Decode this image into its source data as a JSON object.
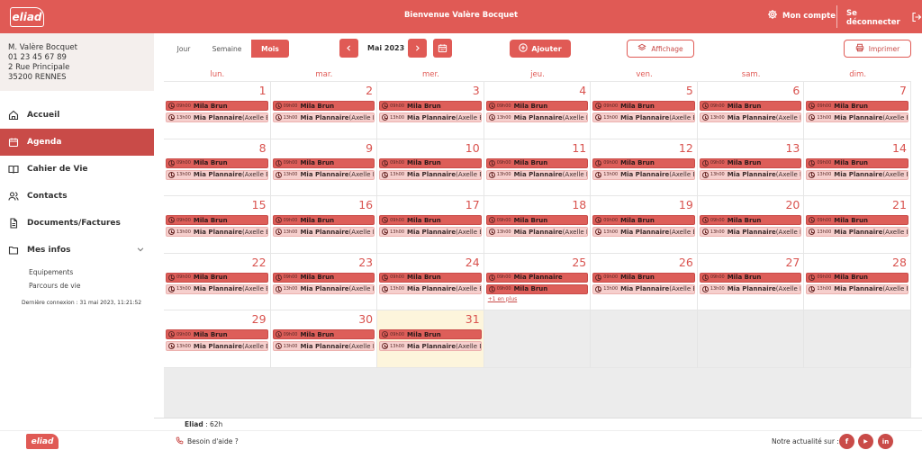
{
  "header": {
    "logo_text": "eliad",
    "welcome": "Bienvenue Valère Bocquet",
    "account_label": "Mon compte",
    "logout_label": "Se déconnecter"
  },
  "user": {
    "name": "M. Valère Bocquet",
    "phone": "01 23 45 67 89",
    "street": "2 Rue Principale",
    "city": "35200 RENNES"
  },
  "nav": {
    "items": [
      {
        "label": "Accueil",
        "icon": "home-icon"
      },
      {
        "label": "Agenda",
        "icon": "calendar-icon",
        "active": true
      },
      {
        "label": "Cahier de Vie",
        "icon": "book-icon"
      },
      {
        "label": "Contacts",
        "icon": "users-icon"
      },
      {
        "label": "Documents/Factures",
        "icon": "document-icon"
      },
      {
        "label": "Mes infos",
        "icon": "folder-icon"
      }
    ],
    "sub_items": [
      "Equipements",
      "Parcours de vie"
    ],
    "last_connection": "Dernière connexion : 31 mai 2023, 11:21:52"
  },
  "toolbar": {
    "views": [
      "Jour",
      "Semaine",
      "Mois"
    ],
    "active_view": "Mois",
    "month": "Mai 2023",
    "add_label": "Ajouter",
    "display_label": "Affichage",
    "print_label": "Imprimer"
  },
  "calendar": {
    "weekdays": [
      "lun.",
      "mar.",
      "mer.",
      "jeu.",
      "ven.",
      "sam.",
      "dim."
    ],
    "more_label": "+1 en plus",
    "weeks": [
      [
        {
          "day": "1",
          "events": [
            {
              "t": "09h00",
              "n": "Mila Brun",
              "k": "dark"
            },
            {
              "t": "13h00",
              "n": "Mia Plannaire",
              "s": "(Axelle Bocquet)",
              "k": "light"
            }
          ]
        },
        {
          "day": "2",
          "events": [
            {
              "t": "09h00",
              "n": "Mila Brun",
              "k": "dark"
            },
            {
              "t": "13h00",
              "n": "Mia Plannaire",
              "s": "(Axelle Bocquet)",
              "k": "light"
            }
          ]
        },
        {
          "day": "3",
          "events": [
            {
              "t": "09h00",
              "n": "Mila Brun",
              "k": "dark"
            },
            {
              "t": "13h00",
              "n": "Mia Plannaire",
              "s": "(Axelle Bocquet)",
              "k": "light"
            }
          ]
        },
        {
          "day": "4",
          "events": [
            {
              "t": "09h00",
              "n": "Mila Brun",
              "k": "dark"
            },
            {
              "t": "13h00",
              "n": "Mia Plannaire",
              "s": "(Axelle Bocquet)",
              "k": "light"
            }
          ]
        },
        {
          "day": "5",
          "events": [
            {
              "t": "09h00",
              "n": "Mila Brun",
              "k": "dark"
            },
            {
              "t": "13h00",
              "n": "Mia Plannaire",
              "s": "(Axelle Bocquet)",
              "k": "light"
            }
          ]
        },
        {
          "day": "6",
          "events": [
            {
              "t": "09h00",
              "n": "Mila Brun",
              "k": "dark"
            },
            {
              "t": "13h00",
              "n": "Mia Plannaire",
              "s": "(Axelle Bocquet)",
              "k": "light"
            }
          ]
        },
        {
          "day": "7",
          "events": [
            {
              "t": "09h00",
              "n": "Mila Brun",
              "k": "dark"
            },
            {
              "t": "13h00",
              "n": "Mia Plannaire",
              "s": "(Axelle Bocquet)",
              "k": "light"
            }
          ]
        }
      ],
      [
        {
          "day": "8",
          "events": [
            {
              "t": "09h00",
              "n": "Mila Brun",
              "k": "dark"
            },
            {
              "t": "13h00",
              "n": "Mia Plannaire",
              "s": "(Axelle Bocquet)",
              "k": "light"
            }
          ]
        },
        {
          "day": "9",
          "events": [
            {
              "t": "09h00",
              "n": "Mila Brun",
              "k": "dark"
            },
            {
              "t": "13h00",
              "n": "Mia Plannaire",
              "s": "(Axelle Bocquet)",
              "k": "light"
            }
          ]
        },
        {
          "day": "10",
          "events": [
            {
              "t": "09h00",
              "n": "Mila Brun",
              "k": "dark"
            },
            {
              "t": "13h00",
              "n": "Mia Plannaire",
              "s": "(Axelle Bocquet)",
              "k": "light"
            }
          ]
        },
        {
          "day": "11",
          "events": [
            {
              "t": "09h00",
              "n": "Mila Brun",
              "k": "dark"
            },
            {
              "t": "13h00",
              "n": "Mia Plannaire",
              "s": "(Axelle Bocquet)",
              "k": "light"
            }
          ]
        },
        {
          "day": "12",
          "events": [
            {
              "t": "09h00",
              "n": "Mila Brun",
              "k": "dark"
            },
            {
              "t": "13h00",
              "n": "Mia Plannaire",
              "s": "(Axelle Bocquet)",
              "k": "light"
            }
          ]
        },
        {
          "day": "13",
          "events": [
            {
              "t": "09h00",
              "n": "Mila Brun",
              "k": "dark"
            },
            {
              "t": "13h00",
              "n": "Mia Plannaire",
              "s": "(Axelle Bocquet)",
              "k": "light"
            }
          ]
        },
        {
          "day": "14",
          "events": [
            {
              "t": "09h00",
              "n": "Mila Brun",
              "k": "dark"
            },
            {
              "t": "13h00",
              "n": "Mia Plannaire",
              "s": "(Axelle Bocquet)",
              "k": "light"
            }
          ]
        }
      ],
      [
        {
          "day": "15",
          "events": [
            {
              "t": "09h00",
              "n": "Mila Brun",
              "k": "dark"
            },
            {
              "t": "13h00",
              "n": "Mia Plannaire",
              "s": "(Axelle Bocquet)",
              "k": "light"
            }
          ]
        },
        {
          "day": "16",
          "events": [
            {
              "t": "09h00",
              "n": "Mila Brun",
              "k": "dark"
            },
            {
              "t": "13h00",
              "n": "Mia Plannaire",
              "s": "(Axelle Bocquet)",
              "k": "light"
            }
          ]
        },
        {
          "day": "17",
          "events": [
            {
              "t": "09h00",
              "n": "Mila Brun",
              "k": "dark"
            },
            {
              "t": "13h00",
              "n": "Mia Plannaire",
              "s": "(Axelle Bocquet)",
              "k": "light"
            }
          ]
        },
        {
          "day": "18",
          "events": [
            {
              "t": "09h00",
              "n": "Mila Brun",
              "k": "dark"
            },
            {
              "t": "13h00",
              "n": "Mia Plannaire",
              "s": "(Axelle Bocquet)",
              "k": "light"
            }
          ]
        },
        {
          "day": "19",
          "events": [
            {
              "t": "09h00",
              "n": "Mila Brun",
              "k": "dark"
            },
            {
              "t": "13h00",
              "n": "Mia Plannaire",
              "s": "(Axelle Bocquet)",
              "k": "light"
            }
          ]
        },
        {
          "day": "20",
          "events": [
            {
              "t": "09h00",
              "n": "Mila Brun",
              "k": "dark"
            },
            {
              "t": "13h00",
              "n": "Mia Plannaire",
              "s": "(Axelle Bocquet)",
              "k": "light"
            }
          ]
        },
        {
          "day": "21",
          "events": [
            {
              "t": "09h00",
              "n": "Mila Brun",
              "k": "dark"
            },
            {
              "t": "13h00",
              "n": "Mia Plannaire",
              "s": "(Axelle Bocquet)",
              "k": "light"
            }
          ]
        }
      ],
      [
        {
          "day": "22",
          "events": [
            {
              "t": "09h00",
              "n": "Mila Brun",
              "k": "dark"
            },
            {
              "t": "13h00",
              "n": "Mia Plannaire",
              "s": "(Axelle Bocquet)",
              "k": "light"
            }
          ]
        },
        {
          "day": "23",
          "events": [
            {
              "t": "09h00",
              "n": "Mila Brun",
              "k": "dark"
            },
            {
              "t": "13h00",
              "n": "Mia Plannaire",
              "s": "(Axelle Bocquet)",
              "k": "light"
            }
          ]
        },
        {
          "day": "24",
          "events": [
            {
              "t": "09h00",
              "n": "Mila Brun",
              "k": "dark"
            },
            {
              "t": "13h00",
              "n": "Mia Plannaire",
              "s": "(Axelle Bocquet)",
              "k": "light"
            }
          ]
        },
        {
          "day": "25",
          "events": [
            {
              "t": "09h00",
              "n": "Mia Plannaire",
              "k": "dark"
            },
            {
              "t": "09h00",
              "n": "Mila Brun",
              "k": "dark"
            }
          ],
          "more": true
        },
        {
          "day": "26",
          "events": [
            {
              "t": "09h00",
              "n": "Mila Brun",
              "k": "dark"
            },
            {
              "t": "13h00",
              "n": "Mia Plannaire",
              "s": "(Axelle Bocquet)",
              "k": "light"
            }
          ]
        },
        {
          "day": "27",
          "events": [
            {
              "t": "09h00",
              "n": "Mila Brun",
              "k": "dark"
            },
            {
              "t": "13h00",
              "n": "Mia Plannaire",
              "s": "(Axelle Bocquet)",
              "k": "light"
            }
          ]
        },
        {
          "day": "28",
          "events": [
            {
              "t": "09h00",
              "n": "Mila Brun",
              "k": "dark"
            },
            {
              "t": "13h00",
              "n": "Mia Plannaire",
              "s": "(Axelle Bocquet)",
              "k": "light"
            }
          ]
        }
      ],
      [
        {
          "day": "29",
          "events": [
            {
              "t": "09h00",
              "n": "Mila Brun",
              "k": "dark"
            },
            {
              "t": "13h00",
              "n": "Mia Plannaire",
              "s": "(Axelle Bocquet)",
              "k": "light"
            }
          ]
        },
        {
          "day": "30",
          "events": [
            {
              "t": "09h00",
              "n": "Mila Brun",
              "k": "dark"
            },
            {
              "t": "13h00",
              "n": "Mia Plannaire",
              "s": "(Axelle Bocquet)",
              "k": "light"
            }
          ]
        },
        {
          "day": "31",
          "today": true,
          "events": [
            {
              "t": "09h00",
              "n": "Mila Brun",
              "k": "dark"
            },
            {
              "t": "13h00",
              "n": "Mia Plannaire",
              "s": "(Axelle Bocquet)",
              "k": "light"
            }
          ]
        },
        null,
        null,
        null,
        null
      ]
    ]
  },
  "summary": {
    "label": "Eliad",
    "value": " : 62h"
  },
  "footer": {
    "logo_text": "eliad",
    "help_label": "Besoin d'aide ?",
    "social_label": "Notre actualité sur :",
    "social": [
      {
        "icon": "facebook-icon",
        "glyph": "f"
      },
      {
        "icon": "youtube-icon",
        "glyph": "▶"
      },
      {
        "icon": "linkedin-icon",
        "glyph": "in"
      }
    ]
  },
  "colors": {
    "brand": "#e05a55",
    "brand_dark": "#c94b48",
    "event_light": "#f6cfcd",
    "today": "#fdf5dc"
  }
}
